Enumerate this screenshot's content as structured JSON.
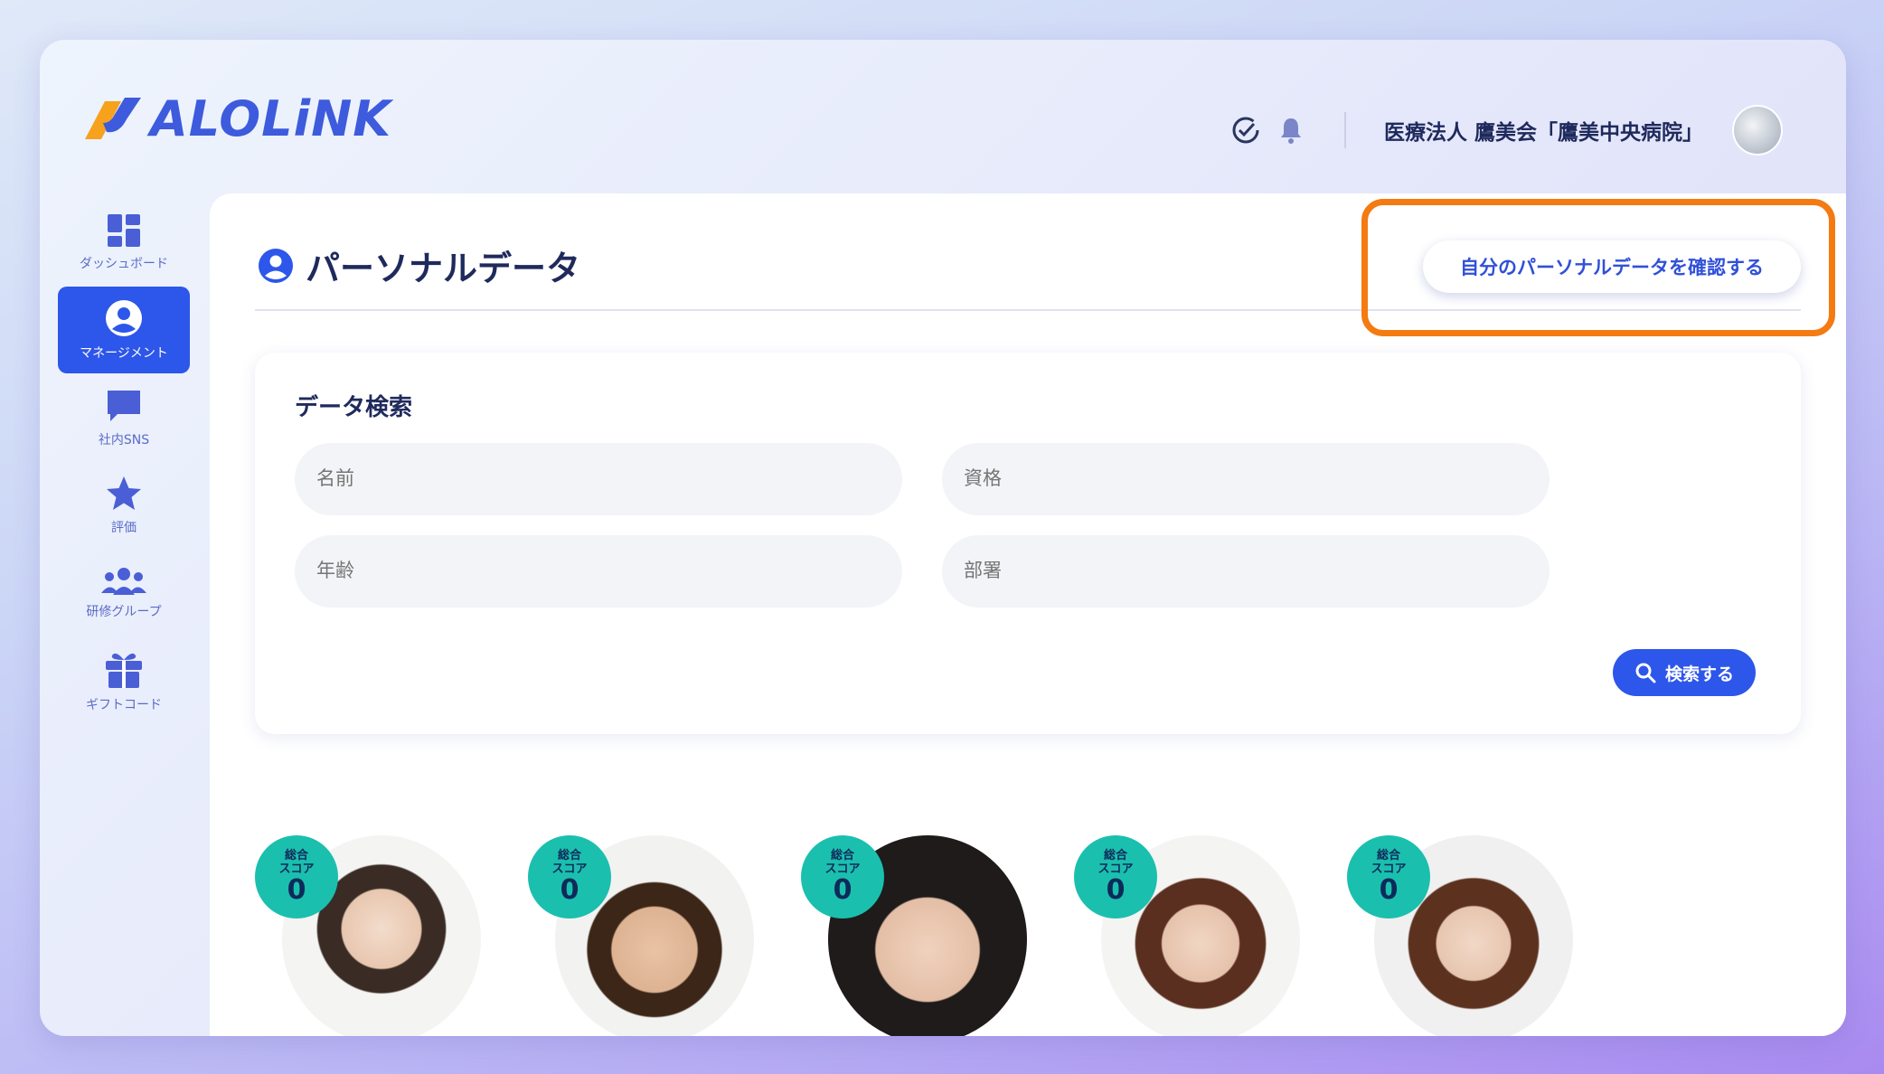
{
  "app": {
    "logo_text": "ALOLiNK"
  },
  "header": {
    "organization": "医療法人 鷹美会「鷹美中央病院」"
  },
  "sidebar": {
    "items": [
      {
        "label": "ダッシュボード",
        "icon": "dashboard-icon"
      },
      {
        "label": "マネージメント",
        "icon": "user-circle-icon",
        "active": true
      },
      {
        "label": "社内SNS",
        "icon": "chat-icon"
      },
      {
        "label": "評価",
        "icon": "star-icon"
      },
      {
        "label": "研修グループ",
        "icon": "group-icon"
      },
      {
        "label": "ギフトコード",
        "icon": "gift-icon"
      }
    ]
  },
  "main": {
    "title": "パーソナルデータ",
    "my_data_button": "自分のパーソナルデータを確認する",
    "search": {
      "title": "データ検索",
      "fields": {
        "name": "名前",
        "qualification": "資格",
        "age": "年齢",
        "department": "部署"
      },
      "button": "検索する"
    },
    "people": [
      {
        "score_label_1": "総合",
        "score_label_2": "スコア",
        "score": "0"
      },
      {
        "score_label_1": "総合",
        "score_label_2": "スコア",
        "score": "0"
      },
      {
        "score_label_1": "総合",
        "score_label_2": "スコア",
        "score": "0"
      },
      {
        "score_label_1": "総合",
        "score_label_2": "スコア",
        "score": "0"
      },
      {
        "score_label_1": "総合",
        "score_label_2": "スコア",
        "score": "0"
      }
    ]
  },
  "colors": {
    "accent": "#2d56ea",
    "highlight": "#f47a12",
    "score_badge": "#1bbfae",
    "title_text": "#1f2a5c"
  }
}
